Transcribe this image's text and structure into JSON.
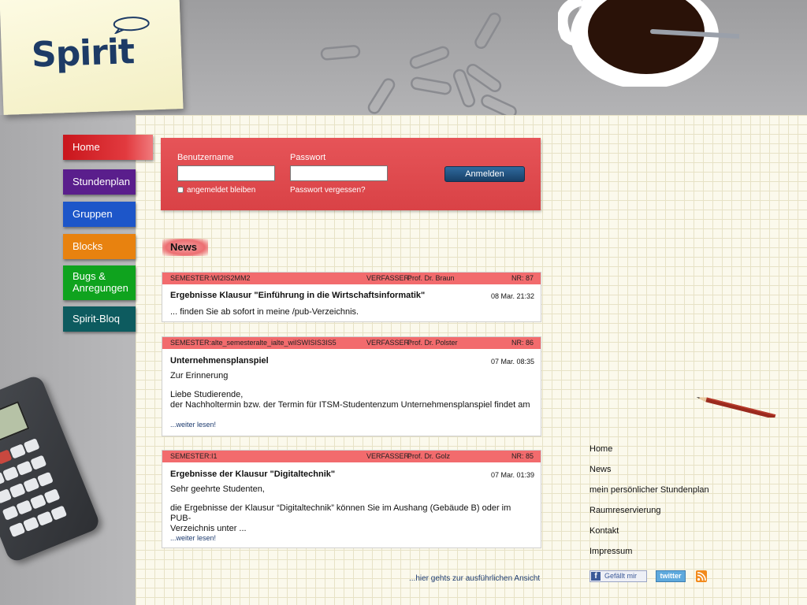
{
  "brand": {
    "name": "Spirit"
  },
  "nav": [
    {
      "id": "home",
      "label": "Home",
      "color": "#d8262b"
    },
    {
      "id": "stundenplan",
      "label": "Stundenplan",
      "color": "#5a1e8c"
    },
    {
      "id": "gruppen",
      "label": "Gruppen",
      "color": "#1d56c9"
    },
    {
      "id": "blocks",
      "label": "Blocks",
      "color": "#e8820f"
    },
    {
      "id": "bugs",
      "label_line1": "Bugs &",
      "label_line2": "Anregungen",
      "color": "#0fa31e"
    },
    {
      "id": "blog",
      "label": "Spirit-Bloq",
      "color": "#0d5b5f"
    }
  ],
  "login": {
    "username_label": "Benutzername",
    "username_value": "",
    "password_label": "Passwort",
    "password_value": "",
    "remember_label": "angemeldet bleiben",
    "remember_checked": false,
    "forgot_label": "Passwort vergessen?",
    "submit_label": "Anmelden"
  },
  "news": {
    "heading": "News",
    "items": [
      {
        "semester_label": "SEMESTER:",
        "semester": "WI2IS2MM2",
        "author_label": "VERFASSER:",
        "author": "Prof. Dr. Braun",
        "nr_label": "NR:",
        "nr": "87",
        "title": "Ergebnisse Klausur \"Einführung in die Wirtschaftsinformatik\"",
        "date": "08 Mar. 21:32",
        "body": [
          "... finden Sie ab sofort in meine /pub-Verzeichnis."
        ],
        "more": ""
      },
      {
        "semester_label": "SEMESTER:",
        "semester": "alte_semesteralte_ialte_wiISWISIS3IS5",
        "author_label": "VERFASSER:",
        "author": "Prof. Dr. Polster",
        "nr_label": "NR:",
        "nr": "86",
        "title": "Unternehmensplanspiel",
        "date": "07 Mar. 08:35",
        "body": [
          "Zur Erinnerung",
          "Liebe Studierende,",
          "der Nachholtermin bzw. der Termin für ITSM-Studentenzum Unternehmensplanspiel findet am"
        ],
        "more": "...weiter lesen!"
      },
      {
        "semester_label": "SEMESTER:",
        "semester": "I1",
        "author_label": "VERFASSER:",
        "author": "Prof. Dr. Golz",
        "nr_label": "NR:",
        "nr": "85",
        "title": "Ergebnisse der Klausur \"Digitaltechnik\"",
        "date": "07 Mar. 01:39",
        "body": [
          "Sehr geehrte Studenten,",
          "die Ergebnisse der Klausur “Digitaltechnik” können Sie im Aushang (Gebäude B) oder im PUB-",
          "Verzeichnis unter ..."
        ],
        "more": "...weiter lesen!"
      }
    ],
    "detail_link": "...hier gehts zur ausführlichen Ansicht"
  },
  "footer": {
    "links": [
      "Home",
      "News",
      "mein persönlicher Stundenplan",
      "Raumreservierung",
      "Kontakt",
      "Impressum"
    ],
    "facebook_label": "Gefällt mir",
    "twitter_label": "twitter"
  }
}
